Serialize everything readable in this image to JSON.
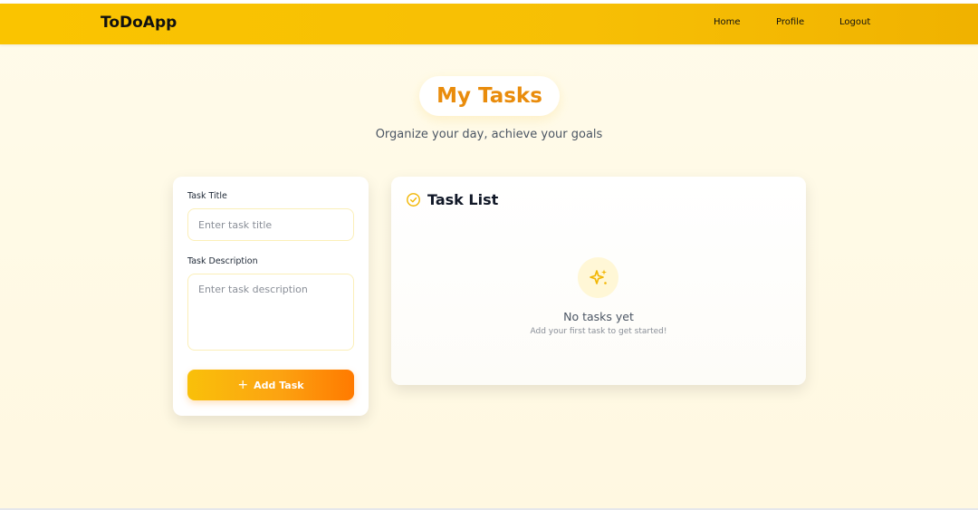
{
  "navbar": {
    "brand": "ToDoApp",
    "links": [
      {
        "label": "Home"
      },
      {
        "label": "Profile"
      },
      {
        "label": "Logout"
      }
    ]
  },
  "hero": {
    "title": "My Tasks",
    "subtitle": "Organize your day, achieve your goals"
  },
  "form": {
    "title_label": "Task Title",
    "title_placeholder": "Enter task title",
    "title_value": "",
    "description_label": "Task Description",
    "description_placeholder": "Enter task description",
    "description_value": "",
    "add_button_icon": "plus-icon",
    "add_button_label": "Add Task"
  },
  "task_list": {
    "header_icon": "check-circle-icon",
    "title": "Task List",
    "empty_icon": "sparkles-icon",
    "empty_title": "No tasks yet",
    "empty_subtitle": "Add your first task to get started!",
    "tasks": []
  },
  "colors": {
    "navbar": "#fac400",
    "title_accent": "#e98c0c",
    "button_start": "#f9c00a",
    "button_end": "#ff7a00",
    "icon_accent": "#f2b705"
  }
}
